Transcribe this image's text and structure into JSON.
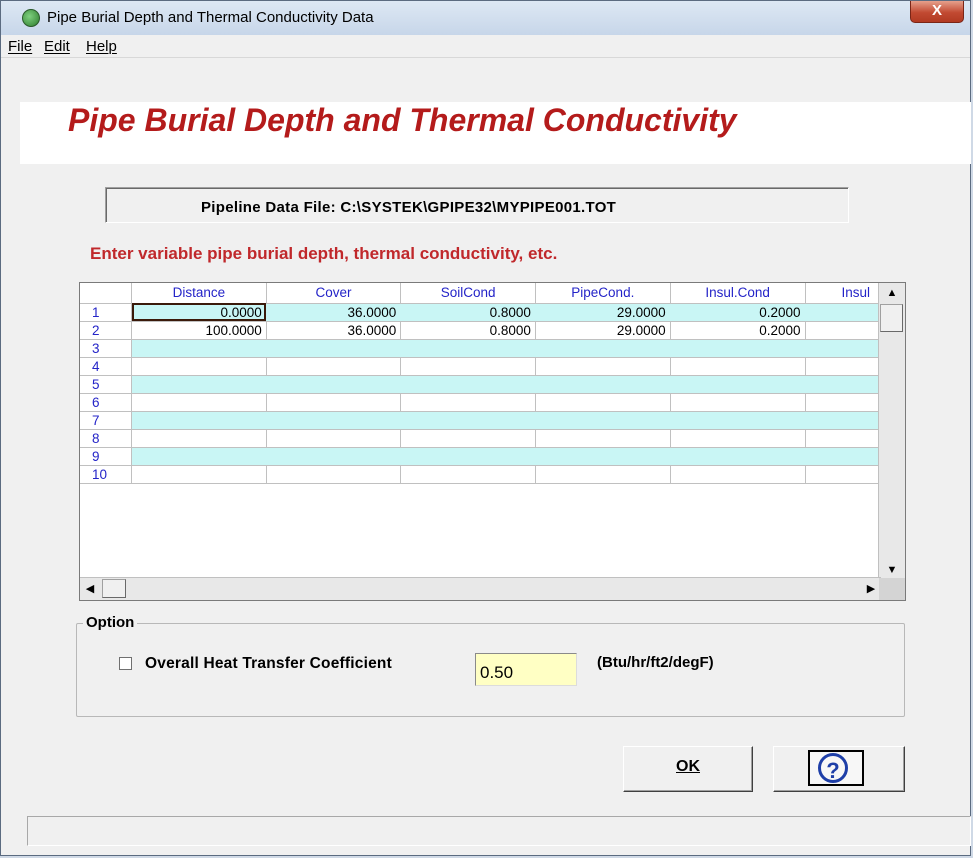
{
  "window": {
    "title": "Pipe Burial Depth and Thermal Conductivity Data",
    "close_label": "X"
  },
  "menu": [
    {
      "label": "File"
    },
    {
      "label": "Edit"
    },
    {
      "label": "Help"
    }
  ],
  "heading": "Pipe Burial Depth and Thermal Conductivity",
  "file_path": "Pipeline Data File: C:\\SYSTEK\\GPIPE32\\MYPIPE001.TOT",
  "instruction": "Enter  variable  pipe burial depth,  thermal conductivity, etc.",
  "grid": {
    "columns": [
      "Distance",
      "Cover",
      "SoilCond",
      "PipeCond.",
      "Insul.Cond",
      "Insul"
    ],
    "rows": [
      {
        "num": "1",
        "cells": [
          "0.0000",
          "36.0000",
          "0.8000",
          "29.0000",
          "0.2000",
          ""
        ]
      },
      {
        "num": "2",
        "cells": [
          "100.0000",
          "36.0000",
          "0.8000",
          "29.0000",
          "0.2000",
          ""
        ]
      },
      {
        "num": "3",
        "cells": [
          "",
          "",
          "",
          "",
          "",
          ""
        ]
      },
      {
        "num": "4",
        "cells": [
          "",
          "",
          "",
          "",
          "",
          ""
        ]
      },
      {
        "num": "5",
        "cells": [
          "",
          "",
          "",
          "",
          "",
          ""
        ]
      },
      {
        "num": "6",
        "cells": [
          "",
          "",
          "",
          "",
          "",
          ""
        ]
      },
      {
        "num": "7",
        "cells": [
          "",
          "",
          "",
          "",
          "",
          ""
        ]
      },
      {
        "num": "8",
        "cells": [
          "",
          "",
          "",
          "",
          "",
          ""
        ]
      },
      {
        "num": "9",
        "cells": [
          "",
          "",
          "",
          "",
          "",
          ""
        ]
      },
      {
        "num": "10",
        "cells": [
          "",
          "",
          "",
          "",
          "",
          ""
        ]
      }
    ],
    "active_cell": "row 1, Distance"
  },
  "option": {
    "group_label": "Option",
    "checkbox_label": "Overall Heat Transfer Coefficient",
    "checked": false,
    "value": "0.50",
    "units": "(Btu/hr/ft2/degF)"
  },
  "buttons": {
    "ok": "OK",
    "help": "?"
  },
  "colors": {
    "heading": "#b41b1b",
    "instruction": "#c0282b",
    "row_alt": "#c9f6f5",
    "header_text": "#2424c8",
    "input_bg": "#ffffc4"
  }
}
